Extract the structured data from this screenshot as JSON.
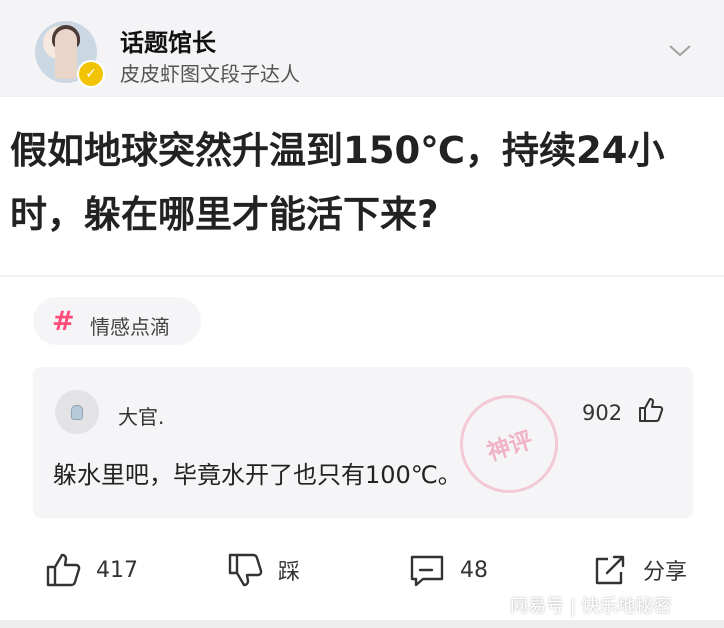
{
  "author": {
    "name": "话题馆长",
    "subtitle": "皮皮虾图文段子达人"
  },
  "question": {
    "text": "假如地球突然升温到150℃，持续24小时，躲在哪里才能活下来?"
  },
  "tag": {
    "label": "情感点滴"
  },
  "top_comment": {
    "author": "大官.",
    "likes": "902",
    "text": "躲水里吧，毕竟水开了也只有100℃。",
    "stamp": "神评"
  },
  "actions": {
    "like_count": "417",
    "dislike_label": "踩",
    "comment_count": "48",
    "share_label": "分享"
  },
  "watermark": "网易号 | 快乐地秘密",
  "colors": {
    "tag_accent": "#ff4d79",
    "verified_badge": "#f2c300"
  }
}
